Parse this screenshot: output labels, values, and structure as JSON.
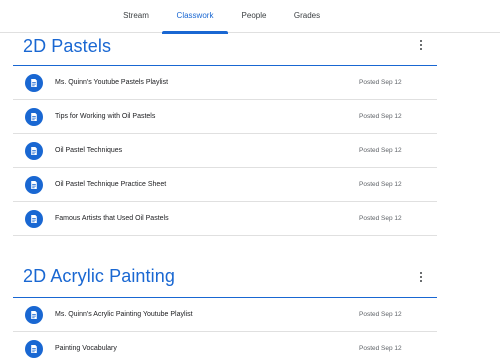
{
  "tabs": [
    {
      "label": "Stream"
    },
    {
      "label": "Classwork"
    },
    {
      "label": "People"
    },
    {
      "label": "Grades"
    }
  ],
  "active_tab": "Classwork",
  "accent_color": "#1967d2",
  "topics": [
    {
      "title": "2D Pastels",
      "menu_icon": "more-vert-icon",
      "items": [
        {
          "icon": "material-icon",
          "title": "Ms. Quinn's Youtube Pastels Playlist",
          "posted": "Posted Sep 12"
        },
        {
          "icon": "material-icon",
          "title": "Tips for Working with Oil Pastels",
          "posted": "Posted Sep 12"
        },
        {
          "icon": "material-icon",
          "title": "Oil Pastel Techniques",
          "posted": "Posted Sep 12"
        },
        {
          "icon": "material-icon",
          "title": "Oil Pastel Technique Practice Sheet",
          "posted": "Posted Sep 12"
        },
        {
          "icon": "material-icon",
          "title": "Famous Artists that Used Oil Pastels",
          "posted": "Posted Sep 12"
        }
      ]
    },
    {
      "title": "2D Acrylic Painting",
      "menu_icon": "more-vert-icon",
      "items": [
        {
          "icon": "material-icon",
          "title": "Ms. Quinn's Acrylic Painting Youtube Playlist",
          "posted": "Posted Sep 12"
        },
        {
          "icon": "material-icon",
          "title": "Painting Vocabulary",
          "posted": "Posted Sep 12"
        }
      ]
    }
  ]
}
